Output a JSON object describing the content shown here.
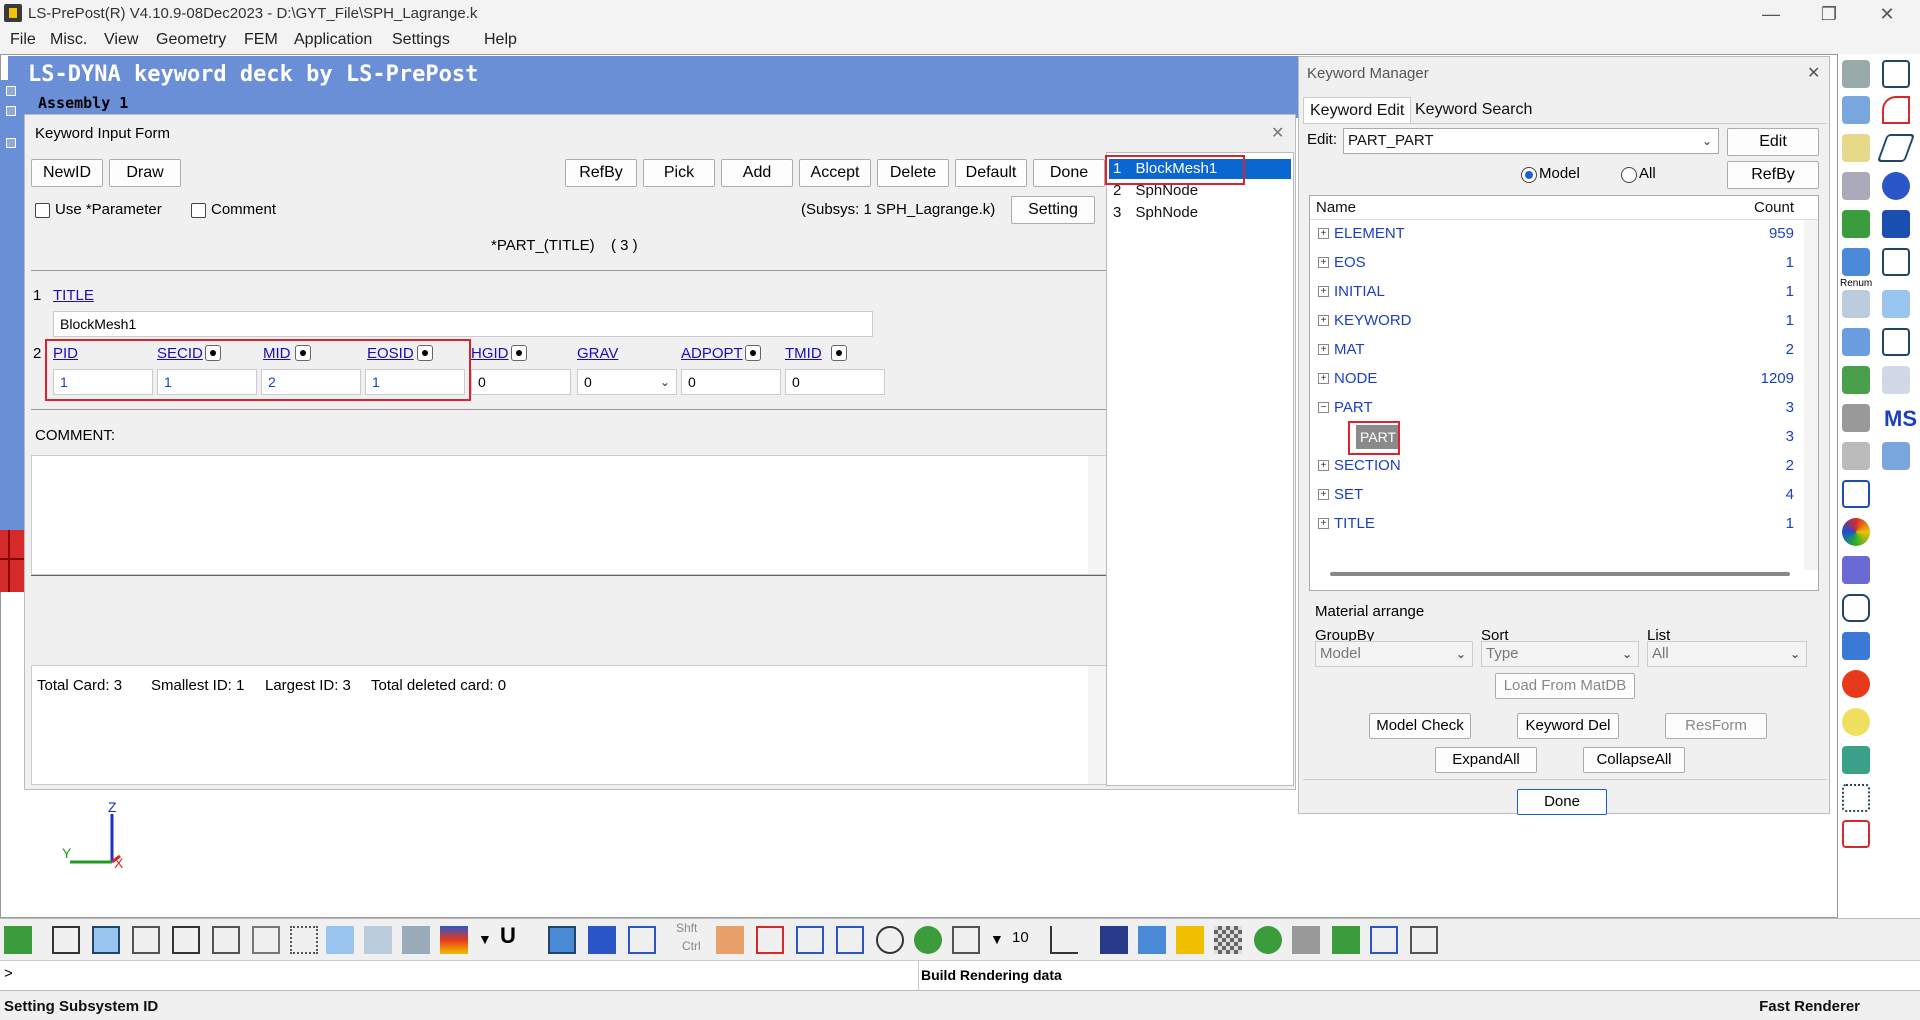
{
  "window": {
    "title": "LS-PrePost(R) V4.10.9-08Dec2023 - D:\\GYT_File\\SPH_Lagrange.k",
    "minimize": "—",
    "maximize": "❐",
    "close": "✕"
  },
  "menu": [
    "File",
    "Misc.",
    "View",
    "Geometry",
    "FEM",
    "Application",
    "Settings",
    "Help"
  ],
  "banner": {
    "title": "LS-DYNA keyword deck by LS-PrePost",
    "assembly": "Assembly 1"
  },
  "kif": {
    "title": "Keyword Input Form",
    "close": "✕",
    "buttons": {
      "newid": "NewID",
      "draw": "Draw",
      "refby": "RefBy",
      "pick": "Pick",
      "add": "Add",
      "accept": "Accept",
      "delete": "Delete",
      "default": "Default",
      "done": "Done",
      "setting": "Setting"
    },
    "use_parameter": "Use *Parameter",
    "comment_check": "Comment",
    "subsys": "(Subsys: 1 SPH_Lagrange.k)",
    "keyword_title": "*PART_(TITLE)",
    "keyword_count": "( 3 )",
    "card1_num": "1",
    "card1_label": "TITLE",
    "title_value": "BlockMesh1",
    "card2_num": "2",
    "card2": [
      {
        "label": "PID",
        "value": "1"
      },
      {
        "label": "SECID",
        "value": "1"
      },
      {
        "label": "MID",
        "value": "2"
      },
      {
        "label": "EOSID",
        "value": "1"
      },
      {
        "label": "HGID",
        "value": "0"
      },
      {
        "label": "GRAV",
        "value": "0"
      },
      {
        "label": "ADPOPT",
        "value": "0"
      },
      {
        "label": "TMID",
        "value": "0"
      }
    ],
    "comment_label": "COMMENT:",
    "summary": {
      "total_card": "Total Card: 3",
      "smallest": "Smallest ID: 1",
      "largest": "Largest ID: 3",
      "deleted": "Total deleted card:  0"
    }
  },
  "part_list": [
    {
      "num": "1",
      "name": "BlockMesh1",
      "selected": true
    },
    {
      "num": "2",
      "name": "SphNode",
      "selected": false
    },
    {
      "num": "3",
      "name": "SphNode",
      "selected": false
    }
  ],
  "km": {
    "title": "Keyword Manager",
    "close": "✕",
    "tabs": [
      "Keyword Edit",
      "Keyword Search"
    ],
    "edit_label": "Edit:",
    "edit_value": "PART_PART",
    "edit_button": "Edit",
    "radio_model": "Model",
    "radio_all": "All",
    "refby_button": "RefBy",
    "col_name": "Name",
    "col_count": "Count",
    "tree": [
      {
        "name": "ELEMENT",
        "count": "959",
        "expanded": false,
        "child": false
      },
      {
        "name": "EOS",
        "count": "1",
        "expanded": false,
        "child": false
      },
      {
        "name": "INITIAL",
        "count": "1",
        "expanded": false,
        "child": false
      },
      {
        "name": "KEYWORD",
        "count": "1",
        "expanded": false,
        "child": false
      },
      {
        "name": "MAT",
        "count": "2",
        "expanded": false,
        "child": false
      },
      {
        "name": "NODE",
        "count": "1209",
        "expanded": false,
        "child": false
      },
      {
        "name": "PART",
        "count": "3",
        "expanded": true,
        "child": false
      },
      {
        "name": "PART",
        "count": "3",
        "expanded": false,
        "child": true
      },
      {
        "name": "SECTION",
        "count": "2",
        "expanded": false,
        "child": false
      },
      {
        "name": "SET",
        "count": "4",
        "expanded": false,
        "child": false
      },
      {
        "name": "TITLE",
        "count": "1",
        "expanded": false,
        "child": false
      }
    ],
    "material_arrange": "Material arrange",
    "groupby_label": "GroupBy",
    "sort_label": "Sort",
    "list_label": "List",
    "groupby_value": "Model",
    "sort_value": "Type",
    "list_value": "All",
    "load_matdb": "Load From MatDB",
    "model_check": "Model Check",
    "keyword_del": "Keyword Del",
    "resform": "ResForm",
    "expand_all": "ExpandAll",
    "collapse_all": "CollapseAll",
    "done": "Done"
  },
  "axes": {
    "z": "Z",
    "y": "Y",
    "x": "X"
  },
  "bottom": {
    "shft": "Shft",
    "ctrl": "Ctrl",
    "ten": "10",
    "u_label": "U",
    "prompt": ">",
    "build": "Build Rendering data"
  },
  "status": {
    "left": "Setting Subsystem ID",
    "right": "Fast Renderer"
  },
  "right_toolbar": {
    "renum": "Renum",
    "ms": "MS"
  },
  "colors": {
    "accent_blue": "#6b8fd6",
    "selection": "#0a66d0",
    "highlight_red": "#d9232e",
    "link_blue": "#1a0dbf"
  }
}
